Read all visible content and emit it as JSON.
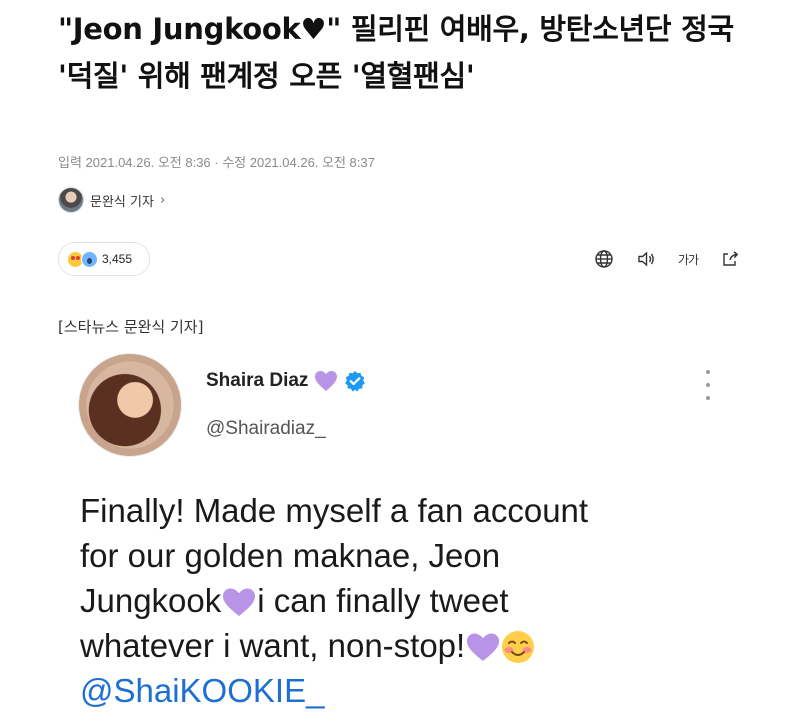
{
  "article": {
    "title": "\"Jeon Jungkook♥\" 필리핀 여배우, 방탄소년단 정국 '덕질' 위해 팬계정 오픈 '열혈팬심'",
    "meta": "입력 2021.04.26. 오전 8:36 · 수정 2021.04.26. 오전 8:37",
    "reporter": "문완식 기자",
    "reporter_chevron": "›",
    "reaction_count": "3,455",
    "font_size_label": "가가",
    "caption": "[스타뉴스 문완식 기자]"
  },
  "icons": {
    "globe": "globe-icon",
    "speaker": "speaker-icon",
    "font_size": "font-size-icon",
    "share": "share-icon"
  },
  "tweet": {
    "name": "Shaira Diaz",
    "handle": "@Shairadiaz_",
    "body": {
      "line1": "Finally! Made myself a fan account",
      "line2": "for our golden maknae,  Jeon",
      "line3a": "Jungkook",
      "line3b": "i can finally tweet",
      "line4": "whatever i want, non-stop!",
      "mention": "@ShaiKOOKIE_"
    }
  },
  "colors": {
    "heart_purple": "#b794e6",
    "verified_blue": "#1d9bf0",
    "mention_blue": "#1d6fd1"
  }
}
